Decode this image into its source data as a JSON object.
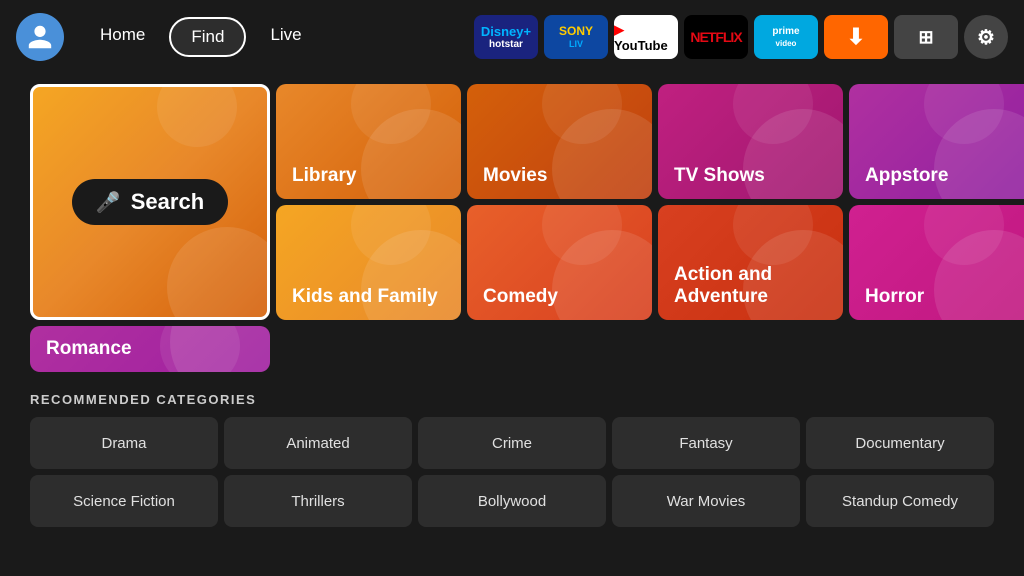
{
  "nav": {
    "home_label": "Home",
    "find_label": "Find",
    "live_label": "Live"
  },
  "apps": [
    {
      "name": "hotstar",
      "label": "Disney+ Hotstar"
    },
    {
      "name": "sonyliv",
      "label": "SonyLIV"
    },
    {
      "name": "youtube",
      "label": "YouTube"
    },
    {
      "name": "netflix",
      "label": "NETFLIX"
    },
    {
      "name": "prime",
      "label": "prime video"
    },
    {
      "name": "downloader",
      "label": "⬇"
    },
    {
      "name": "grid",
      "label": "⊞"
    },
    {
      "name": "settings",
      "label": "⚙"
    }
  ],
  "categories": [
    {
      "id": "search",
      "label": "Search"
    },
    {
      "id": "library",
      "label": "Library"
    },
    {
      "id": "movies",
      "label": "Movies"
    },
    {
      "id": "tvshows",
      "label": "TV Shows"
    },
    {
      "id": "appstore",
      "label": "Appstore"
    },
    {
      "id": "kids",
      "label": "Kids and Family"
    },
    {
      "id": "comedy",
      "label": "Comedy"
    },
    {
      "id": "action",
      "label": "Action and Adventure"
    },
    {
      "id": "horror",
      "label": "Horror"
    },
    {
      "id": "romance",
      "label": "Romance"
    }
  ],
  "recommended": {
    "title": "RECOMMENDED CATEGORIES",
    "items": [
      "Drama",
      "Animated",
      "Crime",
      "Fantasy",
      "Documentary",
      "Science Fiction",
      "Thrillers",
      "Bollywood",
      "War Movies",
      "Standup Comedy"
    ]
  }
}
